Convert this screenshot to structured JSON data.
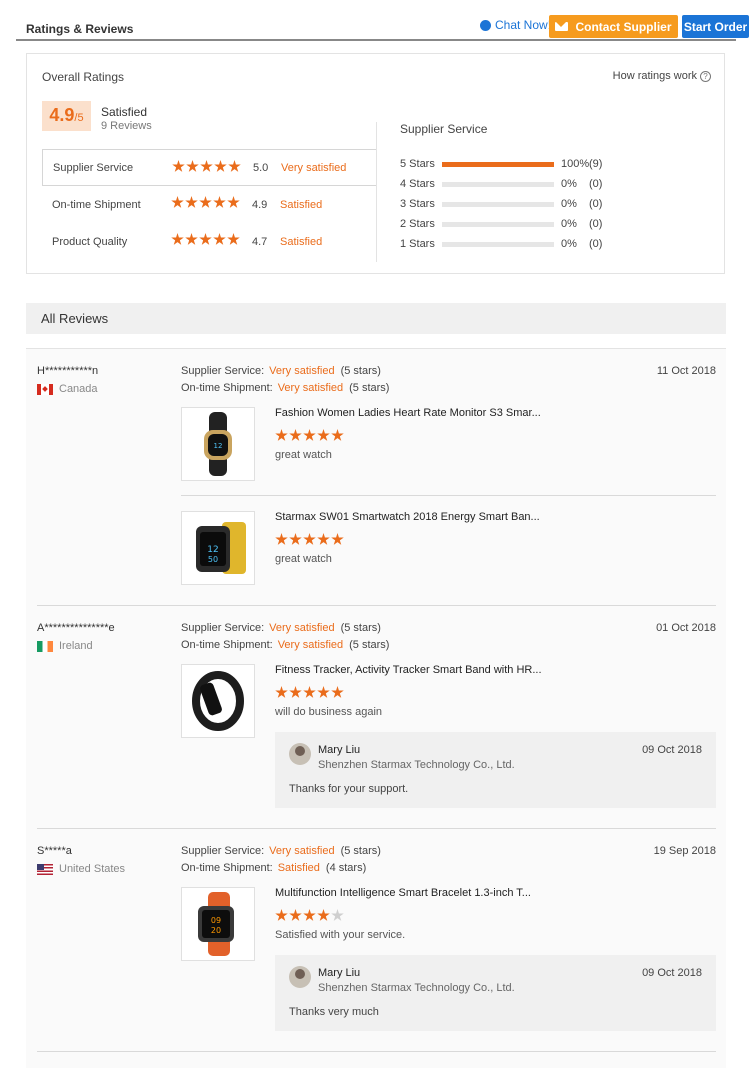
{
  "header": {
    "title": "Ratings & Reviews",
    "chat_label": "Chat Now!",
    "contact_label": "Contact Supplier",
    "start_label": "Start Order"
  },
  "overall": {
    "heading": "Overall Ratings",
    "how_label": "How ratings work",
    "score": "4.9",
    "out_of": "/5",
    "status": "Satisfied",
    "reviews_count": "9 Reviews",
    "metrics": [
      {
        "name": "Supplier Service",
        "score": "5.0",
        "text": "Very satisfied",
        "stars": 5
      },
      {
        "name": "On-time Shipment",
        "score": "4.9",
        "text": "Satisfied",
        "stars": 5
      },
      {
        "name": "Product Quality",
        "score": "4.7",
        "text": "Satisfied",
        "stars": 5
      }
    ],
    "distribution_title": "Supplier Service",
    "distribution": [
      {
        "label": "5  Stars",
        "pct": "100%",
        "count": "(9)",
        "fraction": 1.0
      },
      {
        "label": "4  Stars",
        "pct": "0%",
        "count": "(0)",
        "fraction": 0
      },
      {
        "label": "3  Stars",
        "pct": "0%",
        "count": "(0)",
        "fraction": 0
      },
      {
        "label": "2  Stars",
        "pct": "0%",
        "count": "(0)",
        "fraction": 0
      },
      {
        "label": "1  Stars",
        "pct": "0%",
        "count": "(0)",
        "fraction": 0
      }
    ]
  },
  "all_reviews_label": "All Reviews",
  "reviews": [
    {
      "buyer": "H***********n",
      "country": "Canada",
      "date": "11 Oct 2018",
      "service_label": "Supplier Service:",
      "service_value": "Very satisfied",
      "service_stars": "(5 stars)",
      "shipment_label": "On-time Shipment:",
      "shipment_value": "Very satisfied",
      "shipment_stars": "(5 stars)",
      "products": [
        {
          "name": "Fashion Women Ladies Heart Rate Monitor S3 Smar...",
          "comment": "great watch",
          "stars": 5
        },
        {
          "name": "Starmax SW01 Smartwatch 2018 Energy Smart Ban...",
          "comment": "great watch",
          "stars": 5
        }
      ]
    },
    {
      "buyer": "A***************e",
      "country": "Ireland",
      "date": "01 Oct 2018",
      "service_label": "Supplier Service:",
      "service_value": "Very satisfied",
      "service_stars": "(5 stars)",
      "shipment_label": "On-time Shipment:",
      "shipment_value": "Very satisfied",
      "shipment_stars": "(5 stars)",
      "products": [
        {
          "name": "Fitness Tracker, Activity Tracker Smart Band with HR...",
          "comment": "will do business again",
          "stars": 5
        }
      ],
      "reply": {
        "name": "Mary Liu",
        "company": "Shenzhen Starmax Technology Co., Ltd.",
        "date": "09 Oct 2018",
        "text": "Thanks for your support."
      }
    },
    {
      "buyer": "S*****a",
      "country": "United States",
      "date": "19 Sep 2018",
      "service_label": "Supplier Service:",
      "service_value": "Very satisfied",
      "service_stars": "(5 stars)",
      "shipment_label": "On-time Shipment:",
      "shipment_value": "Satisfied",
      "shipment_stars": "(4 stars)",
      "products": [
        {
          "name": "Multifunction Intelligence Smart Bracelet 1.3-inch T...",
          "comment": "Satisfied with your service.",
          "stars": 4
        }
      ],
      "reply": {
        "name": "Mary Liu",
        "company": "Shenzhen Starmax Technology Co., Ltd.",
        "date": "09 Oct 2018",
        "text": "Thanks very much"
      }
    }
  ],
  "colors": {
    "accent": "#ea6c1b",
    "blue": "#1b74d6",
    "contact": "#f69b1e"
  }
}
